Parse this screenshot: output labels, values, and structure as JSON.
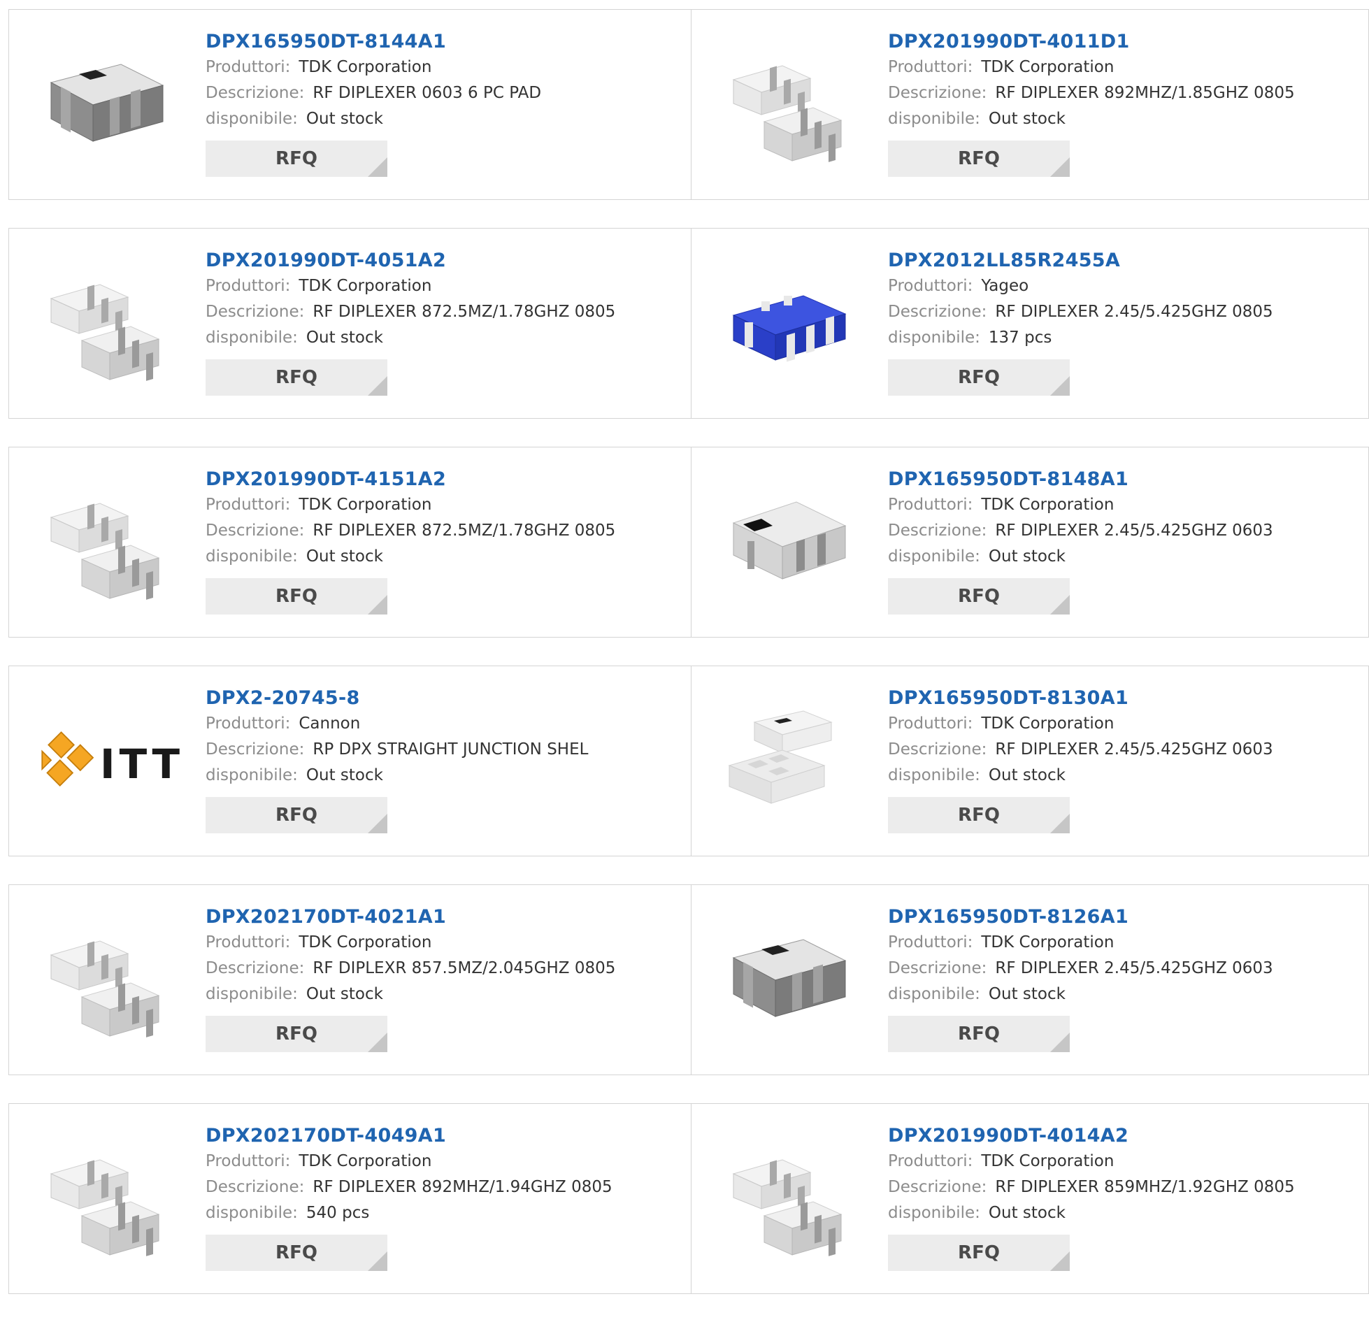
{
  "labels": {
    "manufacturer": "Produttori:",
    "description": "Descrizione:",
    "availability": "disponibile:",
    "rfq": "RFQ"
  },
  "products": [
    {
      "part": "DPX165950DT-8144A1",
      "manufacturer": "TDK Corporation",
      "description": "RF DIPLEXER 0603 6 PC PAD",
      "availability": "Out stock",
      "image": "dark-chip-icon"
    },
    {
      "part": "DPX201990DT-4011D1",
      "manufacturer": "TDK Corporation",
      "description": "RF DIPLEXER 892MHZ/1.85GHZ 0805",
      "availability": "Out stock",
      "image": "two-chips-icon"
    },
    {
      "part": "DPX201990DT-4051A2",
      "manufacturer": "TDK Corporation",
      "description": "RF DIPLEXER 872.5MZ/1.78GHZ 0805",
      "availability": "Out stock",
      "image": "two-chips-icon"
    },
    {
      "part": "DPX2012LL85R2455A",
      "manufacturer": "Yageo",
      "description": "RF DIPLEXER 2.45/5.425GHZ 0805",
      "availability": "137 pcs",
      "image": "blue-chip-icon"
    },
    {
      "part": "DPX201990DT-4151A2",
      "manufacturer": "TDK Corporation",
      "description": "RF DIPLEXER 872.5MZ/1.78GHZ 0805",
      "availability": "Out stock",
      "image": "two-chips-icon"
    },
    {
      "part": "DPX165950DT-8148A1",
      "manufacturer": "TDK Corporation",
      "description": "RF DIPLEXER 2.45/5.425GHZ 0603",
      "availability": "Out stock",
      "image": "light-chip-icon"
    },
    {
      "part": "DPX2-20745-8",
      "manufacturer": "Cannon",
      "description": "RP DPX STRAIGHT JUNCTION SHEL",
      "availability": "Out stock",
      "image": "itt-logo"
    },
    {
      "part": "DPX165950DT-8130A1",
      "manufacturer": "TDK Corporation",
      "description": "RF DIPLEXER 2.45/5.425GHZ 0603",
      "availability": "Out stock",
      "image": "white-chips-icon"
    },
    {
      "part": "DPX202170DT-4021A1",
      "manufacturer": "TDK Corporation",
      "description": "RF DIPLEXR 857.5MZ/2.045GHZ 0805",
      "availability": "Out stock",
      "image": "two-chips-icon"
    },
    {
      "part": "DPX165950DT-8126A1",
      "manufacturer": "TDK Corporation",
      "description": "RF DIPLEXER 2.45/5.425GHZ 0603",
      "availability": "Out stock",
      "image": "dark-chip-icon"
    },
    {
      "part": "DPX202170DT-4049A1",
      "manufacturer": "TDK Corporation",
      "description": "RF DIPLEXER 892MHZ/1.94GHZ 0805",
      "availability": "540 pcs",
      "image": "two-chips-icon"
    },
    {
      "part": "DPX201990DT-4014A2",
      "manufacturer": "TDK Corporation",
      "description": "RF DIPLEXER 859MHZ/1.92GHZ 0805",
      "availability": "Out stock",
      "image": "two-chips-icon"
    }
  ],
  "logo_text": "ITT",
  "colors": {
    "link": "#1f64b0",
    "label": "#8c8c8c",
    "button_bg": "#ececec",
    "border": "#d4d4d4",
    "itt_orange": "#f5a623",
    "blue_chip": "#2a3fc8"
  }
}
